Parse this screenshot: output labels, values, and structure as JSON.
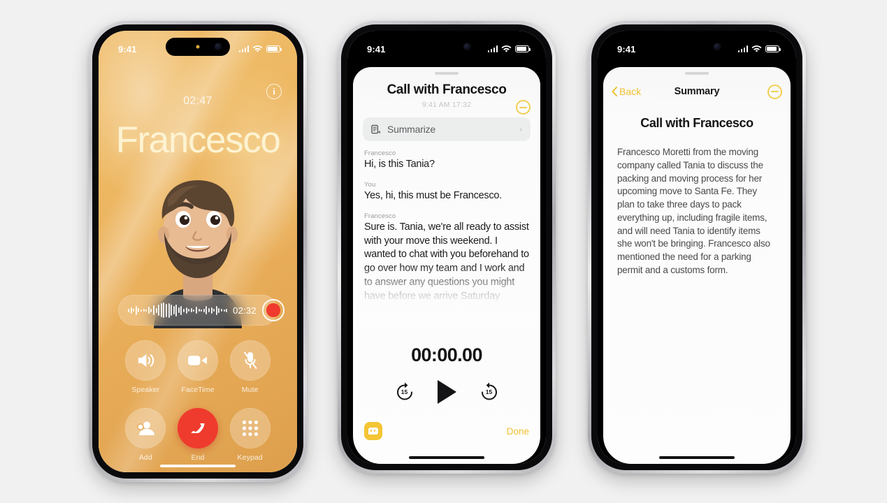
{
  "scene": {
    "background_color": "#f1f1f1",
    "accent_yellow": "#f0c030",
    "record_red": "#ef3b2d"
  },
  "phone1": {
    "name": "active-call-screen",
    "status_bar": {
      "time": "9:41",
      "signal": "signal-bars-icon",
      "wifi": "wifi-icon",
      "battery": "battery-icon"
    },
    "info_button": "i",
    "call_timer": "02:47",
    "caller_name": "Francesco",
    "avatar": "memoji-avatar",
    "recording_pill": {
      "waveform": "audio-waveform",
      "elapsed": "02:32",
      "record_button": "record-dot"
    },
    "controls": [
      {
        "label": "Speaker",
        "icon": "speaker-icon",
        "name": "speaker-button"
      },
      {
        "label": "FaceTime",
        "icon": "video-camera-icon",
        "name": "facetime-button"
      },
      {
        "label": "Mute",
        "icon": "microphone-muted-icon",
        "name": "mute-button"
      },
      {
        "label": "Add",
        "icon": "add-person-icon",
        "name": "add-call-button"
      },
      {
        "label": "End",
        "icon": "end-call-icon",
        "name": "end-call-button"
      },
      {
        "label": "Keypad",
        "icon": "keypad-icon",
        "name": "keypad-button"
      }
    ]
  },
  "phone2": {
    "name": "call-recording-transcript-sheet",
    "status_bar": {
      "time": "9:41"
    },
    "title": "Call with Francesco",
    "subtitle": "9:41 AM  17:32",
    "record_badge": "recording-indicator-icon",
    "summarize": {
      "label": "Summarize",
      "icon": "summarize-icon",
      "chevron": "chevron-right-icon"
    },
    "transcript": [
      {
        "speaker": "Francesco",
        "text": "Hi, is this Tania?",
        "faded": false
      },
      {
        "speaker": "You",
        "text": "Yes, hi, this must be Francesco.",
        "faded": false
      },
      {
        "speaker": "Francesco",
        "text": "Sure is. Tania, we're all ready to assist with your move this weekend. I wanted to chat with you beforehand to go over how my team and I work and to answer any questions you might have before we arrive Saturday",
        "faded": true
      }
    ],
    "player": {
      "time": "00:00.00",
      "skip_back_label": "15",
      "skip_forward_label": "15",
      "play_icon": "play-icon"
    },
    "footer": {
      "transcript_icon": "transcript-bubble-icon",
      "done_label": "Done"
    }
  },
  "phone3": {
    "name": "call-summary-screen",
    "status_bar": {
      "time": "9:41"
    },
    "nav": {
      "back_label": "Back",
      "title": "Summary",
      "record_badge": "recording-indicator-icon"
    },
    "title": "Call with Francesco",
    "summary": "Francesco Moretti from the moving company called Tania to discuss the packing and moving process for her upcoming move to Santa Fe. They plan to take three days to pack everything up, including fragile items, and will need Tania to identify items she won't be bringing. Francesco also mentioned the need for a parking permit and a customs form."
  }
}
